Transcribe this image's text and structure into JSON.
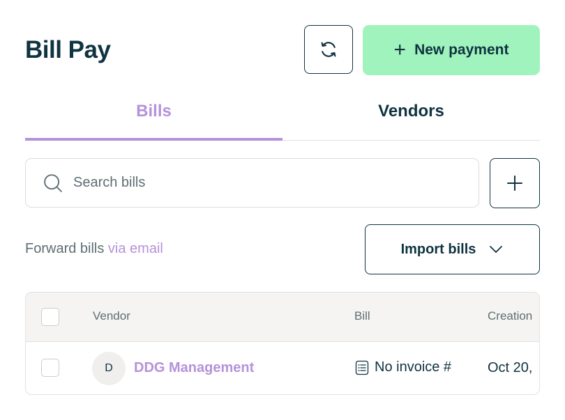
{
  "header": {
    "title": "Bill Pay",
    "new_payment_label": "New payment"
  },
  "tabs": [
    {
      "label": "Bills",
      "active": true
    },
    {
      "label": "Vendors",
      "active": false
    }
  ],
  "search": {
    "placeholder": "Search bills",
    "value": ""
  },
  "forward": {
    "text": "Forward bills ",
    "link_text": "via email"
  },
  "import": {
    "label": "Import bills"
  },
  "table": {
    "columns": [
      "Vendor",
      "Bill",
      "Creation"
    ],
    "rows": [
      {
        "avatar_initial": "D",
        "vendor": "DDG Management",
        "bill": "No invoice #",
        "creation": "Oct 20,"
      }
    ]
  },
  "colors": {
    "accent": "#b592d9",
    "primary_button": "#a1f3bd",
    "text_dark": "#0f3340"
  },
  "icons": [
    "refresh-icon",
    "plus-icon",
    "search-icon",
    "chevron-down-icon",
    "receipt-icon"
  ]
}
